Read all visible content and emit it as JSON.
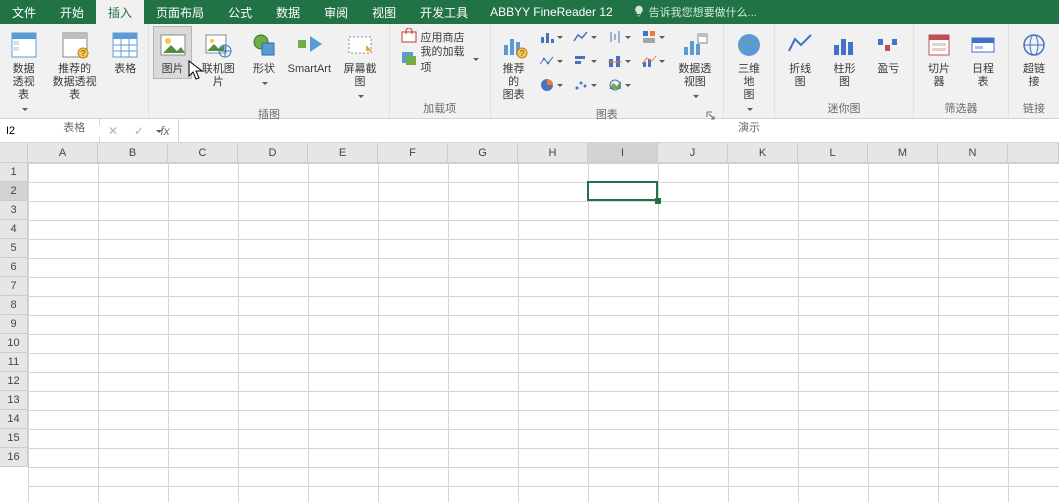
{
  "tabs": {
    "file": "文件",
    "start": "开始",
    "insert": "插入",
    "layout": "页面布局",
    "formula": "公式",
    "data": "数据",
    "review": "审阅",
    "view": "视图",
    "dev": "开发工具",
    "addin": "ABBYY FineReader 12",
    "tellme": "告诉我您想要做什么..."
  },
  "ribbon": {
    "groups": {
      "tables": "表格",
      "illustrations": "插图",
      "addins": "加载项",
      "charts": "图表",
      "demo": "演示",
      "sparklines": "迷你图",
      "filters": "筛选器",
      "links": "链接"
    },
    "btns": {
      "pivot": "数据\n透视表",
      "recpivot": "推荐的\n数据透视表",
      "table": "表格",
      "picture": "图片",
      "online_picture": "联机图片",
      "shapes": "形状",
      "smartart": "SmartArt",
      "screenshot": "屏幕截图",
      "store": "应用商店",
      "myaddins": "我的加载项",
      "recchart": "推荐的\n图表",
      "pivotchart": "数据透视图",
      "map3d": "三维地\n图",
      "spark_line": "折线图",
      "spark_col": "柱形图",
      "spark_wl": "盈亏",
      "slicer": "切片器",
      "timeline": "日程表",
      "hyperlink": "超链接"
    }
  },
  "formula_bar": {
    "namebox": "I2",
    "formula": ""
  },
  "sheet": {
    "columns": [
      "A",
      "B",
      "C",
      "D",
      "E",
      "F",
      "G",
      "H",
      "I",
      "J",
      "K",
      "L",
      "M",
      "N"
    ],
    "rows": [
      "1",
      "2",
      "3",
      "4",
      "5",
      "6",
      "7",
      "8",
      "9",
      "10",
      "11",
      "12",
      "13",
      "14",
      "15",
      "16"
    ],
    "selected_cell": "I2",
    "selected_col_index": 8,
    "selected_row_index": 1
  },
  "colors": {
    "brand": "#217346"
  }
}
